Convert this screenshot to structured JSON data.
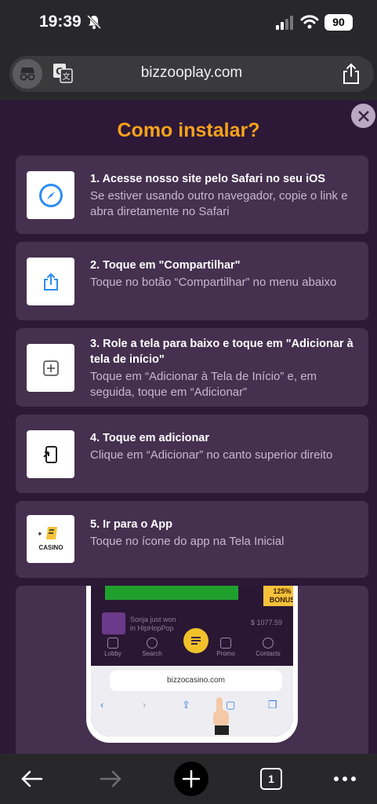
{
  "status": {
    "time": "19:39",
    "battery": "90"
  },
  "browser": {
    "url": "bizzooplay.com"
  },
  "modal": {
    "title": "Como instalar?",
    "steps": [
      {
        "title": "1. Acesse nosso site pelo Safari no seu iOS",
        "desc": "Se estiver usando outro navegador, copie o link e abra diretamente no Safari",
        "icon": "safari-icon"
      },
      {
        "title": "2. Toque em \"Compartilhar\"",
        "desc": "Toque no botão “Compartilhar” no menu abaixo",
        "icon": "share-icon"
      },
      {
        "title": "3. Role a tela para baixo e toque em \"Adicionar à tela de início\"",
        "desc": "Toque em “Adicionar à Tela de Início” e, em seguida, toque em “Adicionar”",
        "icon": "add-square-icon"
      },
      {
        "title": "4. Toque em adicionar",
        "desc": "Clique em “Adicionar” no canto superior direito",
        "icon": "add-to-home-icon"
      },
      {
        "title": "5. Ir para o App",
        "desc": "Toque no ícone do app na Tela Inicial",
        "icon": "casino-app-icon",
        "app_icon_text": "CASINO"
      }
    ]
  },
  "preview": {
    "bonus": "125% BONUS",
    "winner_line1": "Sonja just won",
    "winner_line2": "in HipHopPop",
    "winner_amount": "$ 1077.59",
    "nav": [
      "Lobby",
      "Search",
      "Promo",
      "Contacts"
    ],
    "safari_url": "bizzocasino.com"
  },
  "toolbar": {
    "tab_count": "1"
  }
}
